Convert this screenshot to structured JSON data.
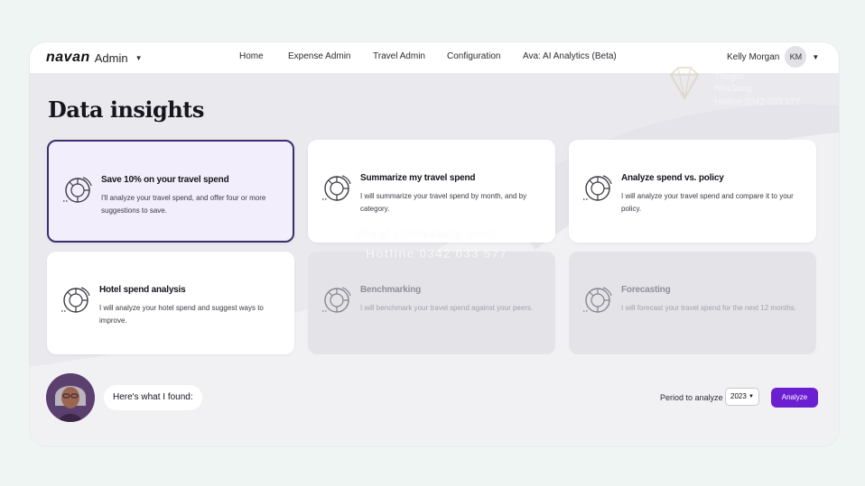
{
  "header": {
    "logo": "navan",
    "product": "Admin",
    "nav": [
      "Home",
      "Expense Admin",
      "Travel Admin",
      "Configuration",
      "Ava: AI Analytics (Beta)"
    ],
    "user_name": "Kelly Morgan",
    "user_initials": "KM"
  },
  "page_title": "Data insights",
  "cards": [
    {
      "title": "Save 10% on your travel spend",
      "desc": "I'll analyze your travel spend, and offer four or more suggestions to save.",
      "state": "selected"
    },
    {
      "title": "Summarize my travel spend",
      "desc": "I will summarize your travel spend by month, and by category.",
      "state": "enabled"
    },
    {
      "title": "Analyze spend vs. policy",
      "desc": "I will analyze your travel spend and compare it to your policy.",
      "state": "enabled"
    },
    {
      "title": "Hotel spend analysis",
      "desc": "I will analyze your hotel spend and suggest ways to improve.",
      "state": "enabled"
    },
    {
      "title": "Benchmarking",
      "desc": "I will benchmark your travel spend against your peers.",
      "state": "disabled"
    },
    {
      "title": "Forecasting",
      "desc": "I will forecast your travel spend for the next 12 months.",
      "state": "disabled"
    }
  ],
  "assistant": {
    "message": "Here's what I found:"
  },
  "controls": {
    "period_label": "Period to analyze",
    "year": "2023",
    "analyze_label": "Analyze"
  },
  "watermark": {
    "line1": "Thegioi",
    "line2": "NhaSang",
    "line3": "Hotline 0342 033 577",
    "center1": "thegioinhasang.com",
    "center2": "Hotline 0342 033 577"
  },
  "colors": {
    "accent": "#6c1fd0",
    "selected_border": "#3b2f6e",
    "selected_bg": "#f2eefb"
  },
  "icons": {
    "card": "chart-analysis-icon",
    "caret": "chevron-down-icon"
  }
}
